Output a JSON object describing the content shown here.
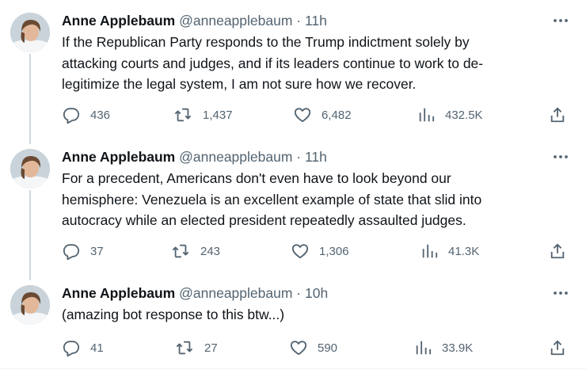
{
  "tweets": [
    {
      "name": "Anne Applebaum",
      "handle": "@anneapplebaum",
      "time": "· 11h",
      "text": "If the Republican Party responds to the Trump indictment solely by\nattacking courts and judges, and if its leaders continue to work to de-\nlegitimize the legal system, I am not sure how we recover.",
      "replies": "436",
      "retweets": "1,437",
      "likes": "6,482",
      "views": "432.5K"
    },
    {
      "name": "Anne Applebaum",
      "handle": "@anneapplebaum",
      "time": "· 11h",
      "text": "For a precedent, Americans don't even have to look beyond our\nhemisphere: Venezuela is an excellent example of state that slid into\nautocracy while an elected president repeatedly assaulted judges.",
      "replies": "37",
      "retweets": "243",
      "likes": "1,306",
      "views": "41.3K"
    },
    {
      "name": "Anne Applebaum",
      "handle": "@anneapplebaum",
      "time": "· 10h",
      "text": "(amazing bot response to this btw...)",
      "replies": "41",
      "retweets": "27",
      "likes": "590",
      "views": "33.9K"
    }
  ],
  "icons": {
    "reply": "reply-icon",
    "retweet": "retweet-icon",
    "like": "heart-icon",
    "views": "views-icon",
    "share": "share-icon",
    "more": "more-icon"
  },
  "colors": {
    "text": "#0f1419",
    "muted": "#536471",
    "thread_line": "#cfd9de"
  }
}
